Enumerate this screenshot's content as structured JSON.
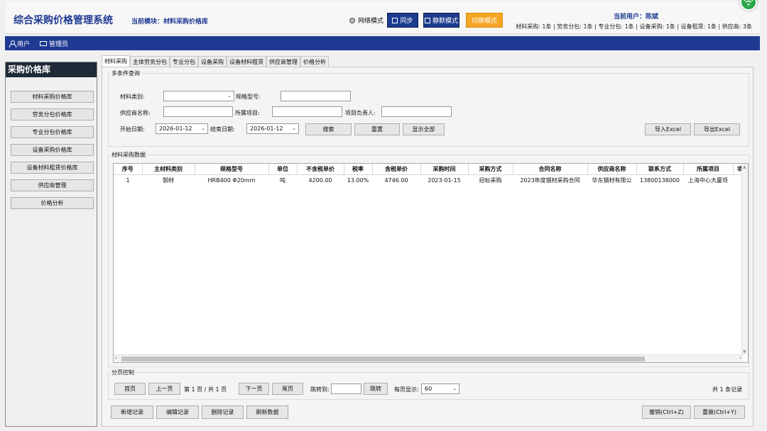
{
  "header": {
    "app_title": "综合采购价格管理系统",
    "module_label": "当前模块：材料采购价格库",
    "network_mode": "网络模式",
    "sync_button": "同步",
    "silent_button": "静默模式",
    "switch_button": "切换模式",
    "current_user": "当前用户：陈斌",
    "stats": "材料采购: 1条 | 劳务分包: 1条 | 专业分包: 1条 | 设备采购: 1条 | 设备租赁: 1条 | 供应商: 3条"
  },
  "topbar": {
    "user": "用户",
    "admin": "管理员"
  },
  "sidebar": {
    "title": "采购价格库",
    "items": [
      "材料采购价格库",
      "劳务分包价格库",
      "专业分包价格库",
      "设备采购价格库",
      "设备材料租赁价格库",
      "供应商管理",
      "价格分析"
    ]
  },
  "tabs": [
    "材料采购",
    "主体劳务分包",
    "专业分包",
    "设备采购",
    "设备材料租赁",
    "供应商管理",
    "价格分析"
  ],
  "filter": {
    "legend": "多条件查询",
    "material_type_label": "材料类别:",
    "material_type_value": "",
    "spec_label": "规格型号:",
    "spec_value": "",
    "supplier_label": "供应商名称:",
    "supplier_value": "",
    "project_label": "所属项目:",
    "project_value": "",
    "manager_label": "项目负责人:",
    "manager_value": "",
    "start_label": "开始日期:",
    "start_value": "2026-01-12",
    "end_label": "结束日期:",
    "end_value": "2026-01-12",
    "search_button": "搜索",
    "reset_button": "重置",
    "show_all_button": "显示全部",
    "import_button": "导入Excel",
    "export_button": "导出Excel"
  },
  "table": {
    "legend": "材料采购数据",
    "columns": [
      "序号",
      "主材料类别",
      "规格型号",
      "单位",
      "不含税单价",
      "税率",
      "含税单价",
      "采购时间",
      "采购方式",
      "合同名称",
      "供应商名称",
      "联系方式",
      "所属项目",
      "项"
    ],
    "rows": [
      [
        "1",
        "钢材",
        "HRB400 Φ20mm",
        "吨",
        "4200.00",
        "13.00%",
        "4746.00",
        "2023-01-15",
        "招标采购",
        "2023年度钢材采购合同",
        "华东钢材有限公",
        "13800138000",
        "上海中心大厦项",
        ""
      ]
    ]
  },
  "pagination": {
    "legend": "分页控制",
    "first": "首页",
    "prev": "上一页",
    "page_info": "第 1 页 / 共 1 页",
    "next": "下一页",
    "last": "尾页",
    "jump_label": "跳转到:",
    "jump_value": "",
    "jump_button": "跳转",
    "per_page_label": "每页显示:",
    "per_page_value": "60",
    "total": "共 1 条记录"
  },
  "actions": {
    "add": "新增记录",
    "edit": "编辑记录",
    "delete": "删除记录",
    "refresh": "刷新数据",
    "undo": "撤销(Ctrl+Z)",
    "redo": "重做(Ctrl+Y)"
  },
  "colors": {
    "brand_blue": "#1f3a93",
    "orange": "#f5a623",
    "sidebar_title_bg": "#1e2a38",
    "wifi_green": "#2ba84a"
  }
}
